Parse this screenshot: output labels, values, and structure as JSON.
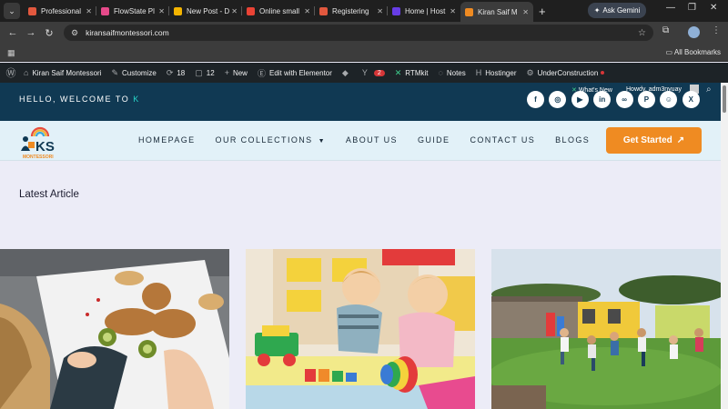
{
  "browser": {
    "tabs": [
      {
        "title": "Professional",
        "fav_color": "#e2583e"
      },
      {
        "title": "FlowState Pl",
        "fav_color": "#e64a8a"
      },
      {
        "title": "New Post - D",
        "fav_color": "#f4b400"
      },
      {
        "title": "Online small",
        "fav_color": "#ea4335"
      },
      {
        "title": "Registering",
        "fav_color": "#e2583e"
      },
      {
        "title": "Home | Host",
        "fav_color": "#673de6"
      },
      {
        "title": "Kiran Saif M",
        "fav_color": "#ef8b22"
      }
    ],
    "gemini_label": "Ask Gemini",
    "url": "kiransaifmontessori.com",
    "all_bookmarks": "All Bookmarks"
  },
  "wpbar": {
    "site_name": "Kiran Saif Montessori",
    "customize": "Customize",
    "updates_count": "18",
    "comments_count": "12",
    "new_label": "New",
    "elementor": "Edit with Elementor",
    "yoast_count": "2",
    "rtmkit": "RTMkit",
    "notes": "Notes",
    "hostinger": "Hostinger",
    "construction": "UnderConstruction"
  },
  "topband": {
    "welcome_text": "HELLO, WELCOME TO",
    "welcome_accent": "K",
    "whats_new": "What's New",
    "howdy": "Howdy, adm3nyuay",
    "socials": [
      {
        "name": "facebook-icon",
        "glyph": "f"
      },
      {
        "name": "instagram-icon",
        "glyph": "◎"
      },
      {
        "name": "youtube-icon",
        "glyph": "▶"
      },
      {
        "name": "linkedin-icon",
        "glyph": "in"
      },
      {
        "name": "link-icon",
        "glyph": "∞"
      },
      {
        "name": "pinterest-icon",
        "glyph": "P"
      },
      {
        "name": "reddit-icon",
        "glyph": "☺"
      },
      {
        "name": "x-icon",
        "glyph": "X"
      }
    ]
  },
  "header": {
    "logo_text": "KS",
    "logo_sub": "MONTESSORI",
    "menu": [
      "HOMEPAGE",
      "OUR COLLECTIONS",
      "ABOUT US",
      "GUIDE",
      "CONTACT US",
      "BLOGS"
    ],
    "cta": "Get Started",
    "cta_icon": "↗"
  },
  "main": {
    "section_title": "Latest Article"
  },
  "colors": {
    "topband": "#103953",
    "accent": "#27d4c8",
    "cta": "#ef8b22"
  }
}
